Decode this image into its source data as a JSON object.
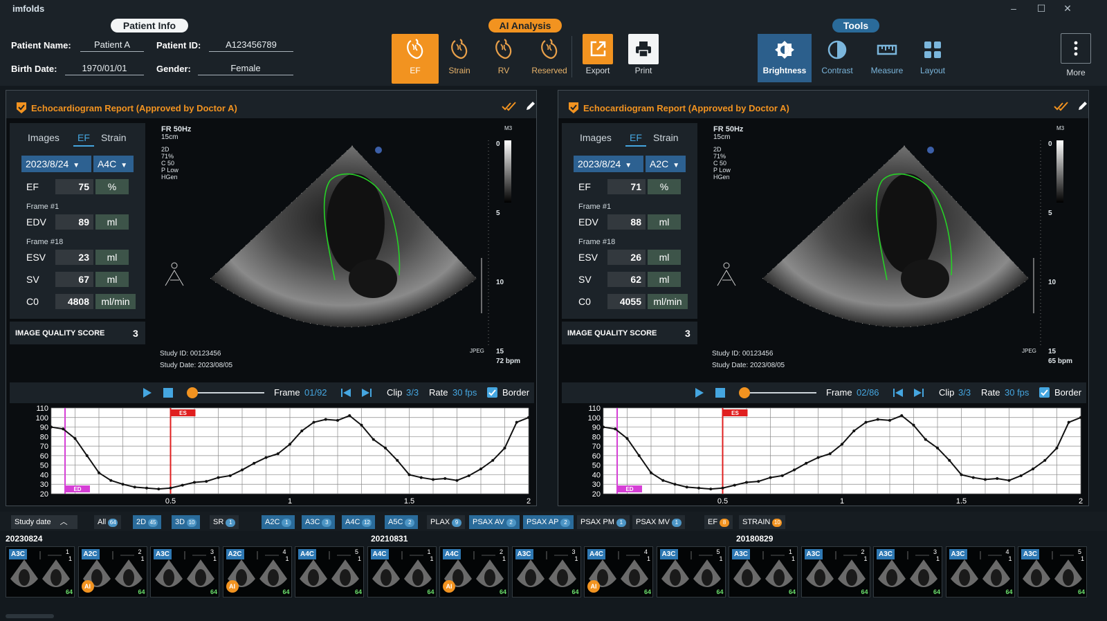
{
  "app": {
    "name": "imfolds"
  },
  "window": {
    "minimize": "–",
    "maximize": "☐",
    "close": "✕"
  },
  "patient": {
    "section": "Patient Info",
    "name_label": "Patient Name:",
    "name": "Patient A",
    "id_label": "Patient ID:",
    "id": "A123456789",
    "birth_label": "Birth Date:",
    "birth": "1970/01/01",
    "gender_label": "Gender:",
    "gender": "Female"
  },
  "ai": {
    "section": "AI Analysis",
    "buttons": [
      {
        "label": "EF",
        "icon": "heart-icon",
        "active": true
      },
      {
        "label": "Strain",
        "icon": "heart-icon"
      },
      {
        "label": "RV",
        "icon": "heart-icon"
      },
      {
        "label": "Reserved",
        "icon": "heart-icon"
      }
    ],
    "export": "Export",
    "print": "Print"
  },
  "tools": {
    "section": "Tools",
    "buttons": [
      {
        "label": "Brightness",
        "icon": "brightness-icon",
        "active": true
      },
      {
        "label": "Contrast",
        "icon": "contrast-icon"
      },
      {
        "label": "Measure",
        "icon": "ruler-icon"
      },
      {
        "label": "Layout",
        "icon": "grid-icon"
      }
    ],
    "more": "More"
  },
  "panels": [
    {
      "title": "Echocardiogram Report (Approved by Doctor A)",
      "tabs": [
        "Images",
        "EF",
        "Strain"
      ],
      "active_tab": "EF",
      "date": "2023/8/24",
      "view": "A4C",
      "ef": {
        "label": "EF",
        "value": "75",
        "unit": "%"
      },
      "frame1": "Frame #1",
      "edv": {
        "label": "EDV",
        "value": "89",
        "unit": "ml"
      },
      "frame18": "Frame #18",
      "esv": {
        "label": "ESV",
        "value": "23",
        "unit": "ml"
      },
      "sv": {
        "label": "SV",
        "value": "67",
        "unit": "ml"
      },
      "co": {
        "label": "C0",
        "value": "4808",
        "unit": "ml/min"
      },
      "iqs_label": "IMAGE QUALITY SCORE",
      "iqs": "3",
      "fr": "FR 50Hz",
      "depth": "15cm",
      "params": [
        "2D",
        "71%",
        "C 50",
        "P Low",
        "HGen"
      ],
      "study_id": "Study ID: 00123456",
      "study_date": "Study Date: 2023/08/05",
      "m3": "M3",
      "jpeg": "JPEG",
      "bpm": "72 bpm",
      "depth_ticks": [
        "0",
        "5",
        "10",
        "15"
      ],
      "frame_label": "Frame",
      "frame": "01/92",
      "clip_label": "Clip",
      "clip": "3/3",
      "rate_label": "Rate",
      "rate": "30 fps",
      "border": "Border",
      "chart_data": {
        "type": "line",
        "x": [
          0.0,
          0.05,
          0.1,
          0.15,
          0.2,
          0.25,
          0.3,
          0.35,
          0.4,
          0.45,
          0.5,
          0.55,
          0.6,
          0.65,
          0.7,
          0.75,
          0.8,
          0.85,
          0.9,
          0.95,
          1.0,
          1.05,
          1.1,
          1.15,
          1.2,
          1.25,
          1.3,
          1.35,
          1.4,
          1.45,
          1.5,
          1.55,
          1.6,
          1.65,
          1.7,
          1.75,
          1.8,
          1.85,
          1.9,
          1.95,
          2.0
        ],
        "y": [
          90,
          88,
          78,
          60,
          42,
          34,
          30,
          27,
          26,
          25,
          26,
          29,
          32,
          33,
          37,
          39,
          45,
          52,
          58,
          62,
          72,
          86,
          95,
          98,
          97,
          102,
          92,
          77,
          68,
          55,
          40,
          37,
          35,
          36,
          34,
          39,
          46,
          55,
          68,
          95,
          100
        ],
        "xlim": [
          0,
          2
        ],
        "ylim": [
          20,
          110
        ],
        "xticks": [
          "0.5",
          "1",
          "1.5",
          "2"
        ],
        "yticks": [
          "110",
          "100",
          "90",
          "80",
          "70",
          "60",
          "50",
          "40",
          "30",
          "20"
        ],
        "markers": [
          {
            "label": "ED",
            "x": 0.0,
            "color": "#d63fd6"
          },
          {
            "label": "ES",
            "x": 0.5,
            "color": "#e01f1f"
          }
        ]
      }
    },
    {
      "title": "Echocardiogram Report (Approved by Doctor A)",
      "tabs": [
        "Images",
        "EF",
        "Strain"
      ],
      "active_tab": "EF",
      "date": "2023/8/24",
      "view": "A2C",
      "ef": {
        "label": "EF",
        "value": "71",
        "unit": "%"
      },
      "frame1": "Frame #1",
      "edv": {
        "label": "EDV",
        "value": "88",
        "unit": "ml"
      },
      "frame18": "Frame #18",
      "esv": {
        "label": "ESV",
        "value": "26",
        "unit": "ml"
      },
      "sv": {
        "label": "SV",
        "value": "62",
        "unit": "ml"
      },
      "co": {
        "label": "C0",
        "value": "4055",
        "unit": "ml/min"
      },
      "iqs_label": "IMAGE QUALITY SCORE",
      "iqs": "3",
      "fr": "FR 50Hz",
      "depth": "15cm",
      "params": [
        "2D",
        "71%",
        "C 50",
        "P Low",
        "HGen"
      ],
      "study_id": "Study ID: 00123456",
      "study_date": "Study Date: 2023/08/05",
      "m3": "M3",
      "jpeg": "JPEG",
      "bpm": "65 bpm",
      "depth_ticks": [
        "0",
        "5",
        "10",
        "15"
      ],
      "frame_label": "Frame",
      "frame": "02/86",
      "clip_label": "Clip",
      "clip": "3/3",
      "rate_label": "Rate",
      "rate": "30 fps",
      "border": "Border",
      "chart_data": {
        "type": "line",
        "x": [
          0.0,
          0.05,
          0.1,
          0.15,
          0.2,
          0.25,
          0.3,
          0.35,
          0.4,
          0.45,
          0.5,
          0.55,
          0.6,
          0.65,
          0.7,
          0.75,
          0.8,
          0.85,
          0.9,
          0.95,
          1.0,
          1.05,
          1.1,
          1.15,
          1.2,
          1.25,
          1.3,
          1.35,
          1.4,
          1.45,
          1.5,
          1.55,
          1.6,
          1.65,
          1.7,
          1.75,
          1.8,
          1.85,
          1.9,
          1.95,
          2.0
        ],
        "y": [
          90,
          88,
          78,
          60,
          42,
          34,
          30,
          27,
          26,
          25,
          26,
          29,
          32,
          33,
          37,
          39,
          45,
          52,
          58,
          62,
          72,
          86,
          95,
          98,
          97,
          102,
          92,
          77,
          68,
          55,
          40,
          37,
          35,
          36,
          34,
          39,
          46,
          55,
          68,
          95,
          100
        ],
        "xlim": [
          0,
          2
        ],
        "ylim": [
          20,
          110
        ],
        "xticks": [
          "0.5",
          "1",
          "1.5",
          "2"
        ],
        "yticks": [
          "110",
          "100",
          "90",
          "80",
          "70",
          "60",
          "50",
          "40",
          "30",
          "20"
        ],
        "markers": [
          {
            "label": "ED",
            "x": 0.0,
            "color": "#d63fd6"
          },
          {
            "label": "ES",
            "x": 0.5,
            "color": "#e01f1f"
          }
        ]
      }
    }
  ],
  "filters": {
    "study_date": "Study date",
    "chips": [
      {
        "label": "All",
        "count": "64",
        "on": false
      },
      {
        "label": "2D",
        "count": "45",
        "on": true
      },
      {
        "label": "3D",
        "count": "10",
        "on": true
      },
      {
        "label": "SR",
        "count": "1",
        "on": false
      },
      {
        "label": "A2C",
        "count": "1",
        "on": true
      },
      {
        "label": "A3C",
        "count": "3",
        "on": true
      },
      {
        "label": "A4C",
        "count": "12",
        "on": true
      },
      {
        "label": "A5C",
        "count": "2",
        "on": true
      },
      {
        "label": "PLAX",
        "count": "9",
        "on": false
      },
      {
        "label": "PSAX AV",
        "count": "2",
        "on": true
      },
      {
        "label": "PSAX AP",
        "count": "2",
        "on": true
      },
      {
        "label": "PSAX PM",
        "count": "1",
        "on": false
      },
      {
        "label": "PSAX MV",
        "count": "1",
        "on": false
      },
      {
        "label": "EF",
        "count": "8",
        "on": false,
        "orange": true
      },
      {
        "label": "STRAIN",
        "count": "10",
        "on": false,
        "orange": true
      }
    ]
  },
  "thumbs": {
    "dates": [
      "20230824",
      "20210831",
      "20180829"
    ],
    "items": [
      {
        "view": "A3C",
        "num": "1",
        "ai": false
      },
      {
        "view": "A2C",
        "num": "2",
        "ai": true
      },
      {
        "view": "A3C",
        "num": "3",
        "ai": false
      },
      {
        "view": "A2C",
        "num": "4",
        "ai": true
      },
      {
        "view": "A4C",
        "num": "5",
        "ai": false
      },
      {
        "view": "A4C",
        "num": "1",
        "ai": false
      },
      {
        "view": "A4C",
        "num": "2",
        "ai": true
      },
      {
        "view": "A3C",
        "num": "3",
        "ai": false
      },
      {
        "view": "A4C",
        "num": "4",
        "ai": true
      },
      {
        "view": "A3C",
        "num": "5",
        "ai": false
      },
      {
        "view": "A3C",
        "num": "1",
        "ai": false
      },
      {
        "view": "A3C",
        "num": "2",
        "ai": false
      },
      {
        "view": "A3C",
        "num": "3",
        "ai": false
      },
      {
        "view": "A3C",
        "num": "4",
        "ai": false
      },
      {
        "view": "A3C",
        "num": "5",
        "ai": false
      }
    ],
    "ai_label": "AI",
    "frames": "64",
    "sub": "1"
  }
}
